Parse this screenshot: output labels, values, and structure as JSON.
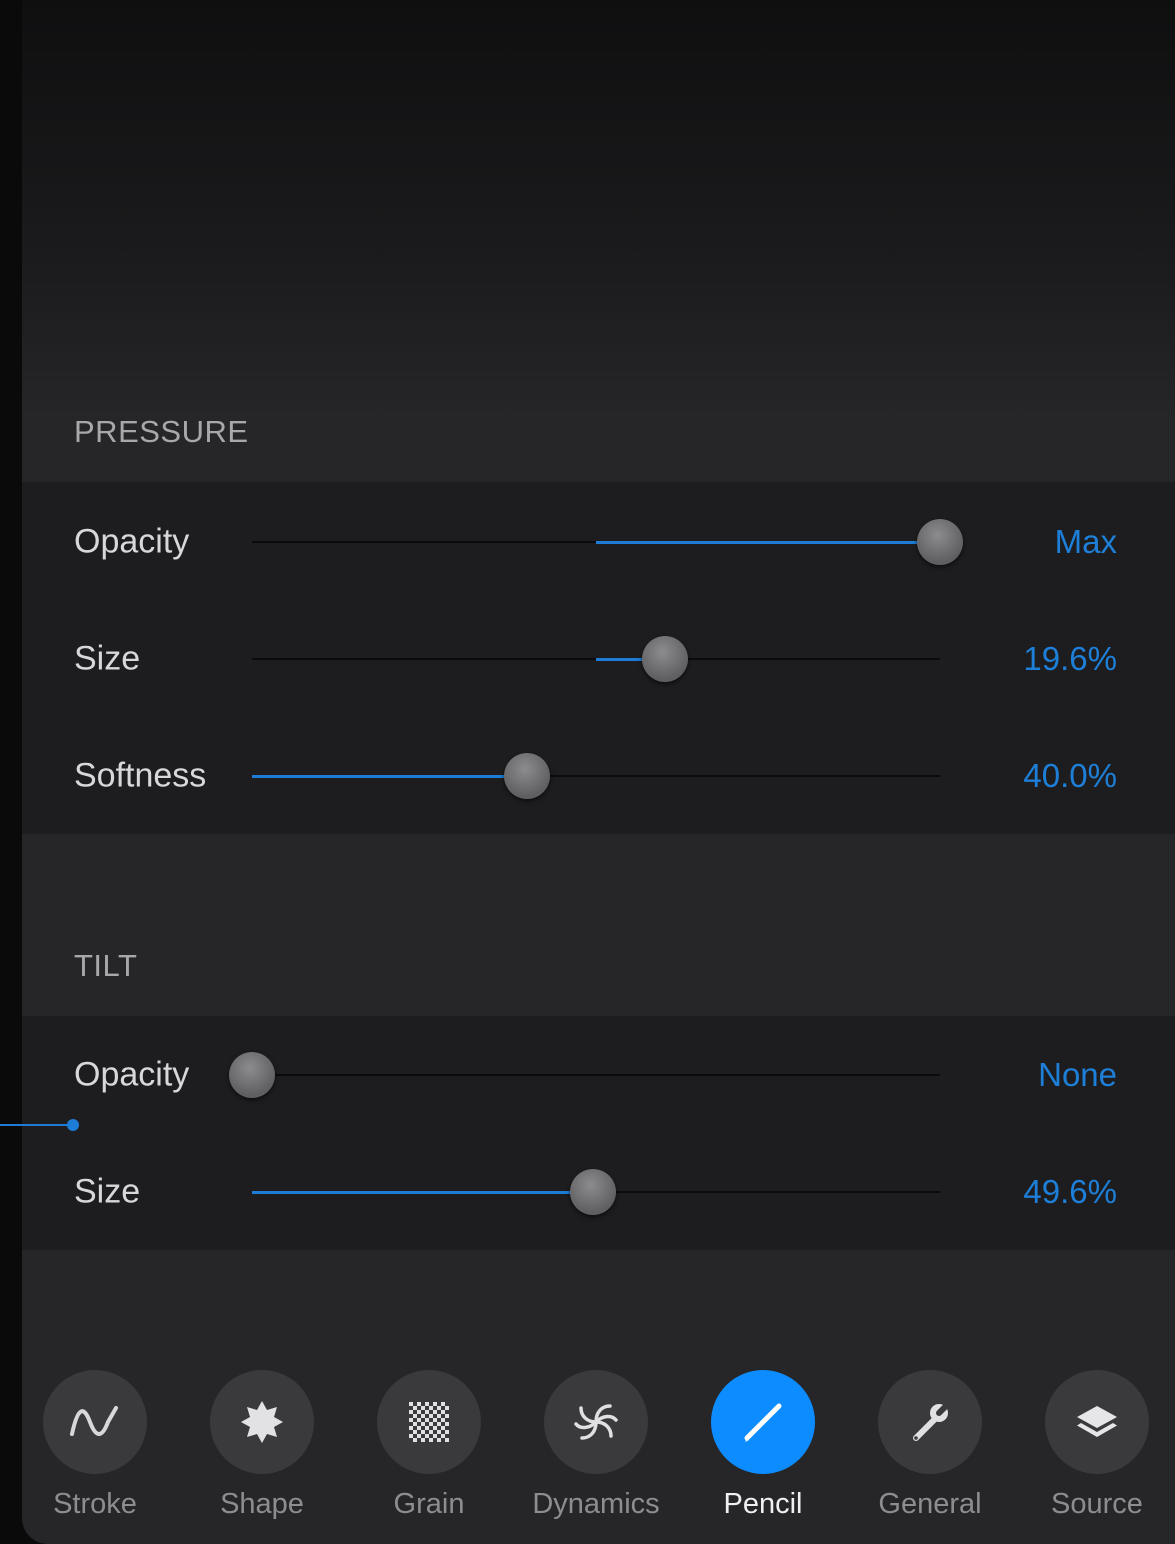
{
  "pressure": {
    "title": "PRESSURE",
    "rows": [
      {
        "label": "Opacity",
        "value_text": "Max",
        "level": 1.0,
        "fill_from": 0.5
      },
      {
        "label": "Size",
        "value_text": "19.6%",
        "level": 0.6,
        "fill_from": 0.5
      },
      {
        "label": "Softness",
        "value_text": "40.0%",
        "level": 0.4,
        "fill_from": 0.0
      }
    ]
  },
  "tilt": {
    "title": "TILT",
    "rows": [
      {
        "label": "Opacity",
        "value_text": "None",
        "level": 0.0,
        "fill_from": 0.0
      },
      {
        "label": "Size",
        "value_text": "49.6%",
        "level": 0.496,
        "fill_from": 0.0
      }
    ]
  },
  "tabs": [
    {
      "label": "Stroke",
      "icon": "stroke-icon"
    },
    {
      "label": "Shape",
      "icon": "shape-icon"
    },
    {
      "label": "Grain",
      "icon": "grain-icon"
    },
    {
      "label": "Dynamics",
      "icon": "dynamics-icon"
    },
    {
      "label": "Pencil",
      "icon": "pencil-icon",
      "active": true
    },
    {
      "label": "General",
      "icon": "wrench-icon"
    },
    {
      "label": "Source",
      "icon": "layers-icon"
    }
  ],
  "colors": {
    "accent": "#1c7cd6",
    "active_tab": "#0d8cff"
  }
}
